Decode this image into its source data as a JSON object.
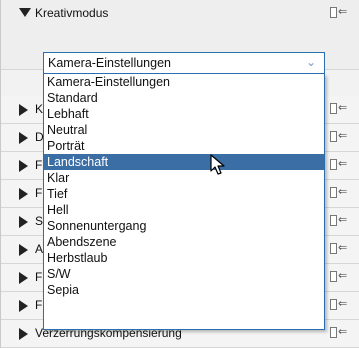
{
  "header": {
    "title": "Kreativmodus"
  },
  "select": {
    "value": "Kamera-Einstellungen",
    "chevron_icon": "chevron-down-icon"
  },
  "dropdown": {
    "options": [
      "Kamera-Einstellungen",
      "Standard",
      "Lebhaft",
      "Neutral",
      "Porträt",
      "Landschaft",
      "Klar",
      "Tief",
      "Hell",
      "Sonnenuntergang",
      "Abendszene",
      "Herbstlaub",
      "S/W",
      "Sepia"
    ],
    "highlighted": "Landschaft",
    "highlight_color": "#3a6ea5"
  },
  "sections": {
    "peek": [
      "K",
      "D",
      "F",
      "F",
      "S",
      "A",
      "F",
      "F"
    ],
    "last_label": "Verzerrungskompensierung"
  },
  "icons": {
    "reset": "reset-icon",
    "expand": "triangle-right-icon",
    "collapse": "triangle-down-icon"
  }
}
